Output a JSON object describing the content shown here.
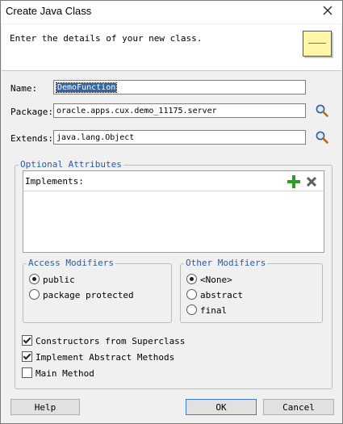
{
  "window": {
    "title": "Create Java Class"
  },
  "header": {
    "text": "Enter the details of your new class."
  },
  "fields": {
    "name": {
      "label": "Name:",
      "value": "DemoFunction"
    },
    "package": {
      "label": "Package:",
      "value": "oracle.apps.cux.demo_11175.server"
    },
    "extends": {
      "label": "Extends:",
      "value": "java.lang.Object"
    }
  },
  "optional_attributes": {
    "legend": "Optional Attributes",
    "implements_label": "Implements:",
    "implements_items": []
  },
  "access_modifiers": {
    "legend": "Access Modifiers",
    "options": [
      "public",
      "package protected"
    ],
    "selected": "public"
  },
  "other_modifiers": {
    "legend": "Other Modifiers",
    "options": [
      "<None>",
      "abstract",
      "final"
    ],
    "selected": "<None>"
  },
  "checkboxes": [
    {
      "label": "Constructors from Superclass",
      "checked": true
    },
    {
      "label": "Implement Abstract Methods",
      "checked": true
    },
    {
      "label": "Main Method",
      "checked": false
    }
  ],
  "buttons": {
    "help": "Help",
    "ok": "OK",
    "cancel": "Cancel"
  },
  "colors": {
    "legend": "#2a5aa8",
    "selection": "#3465a4",
    "add": "#2e9b2e"
  },
  "icons": {
    "close": "close-icon",
    "note": "note-icon",
    "search": "search-icon",
    "add": "plus-icon",
    "remove": "remove-icon"
  }
}
